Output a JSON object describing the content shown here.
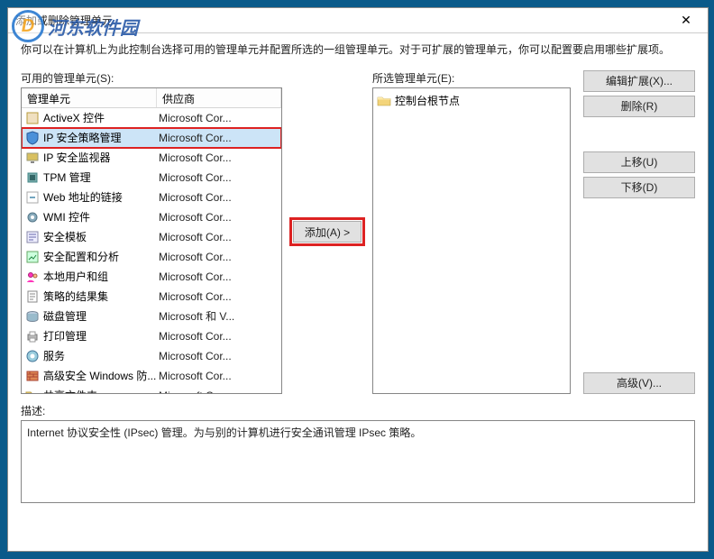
{
  "window": {
    "title": "添加或删除管理单元",
    "close_glyph": "✕"
  },
  "intro": "你可以在计算机上为此控制台选择可用的管理单元并配置所选的一组管理单元。对于可扩展的管理单元，你可以配置要启用哪些扩展项。",
  "available": {
    "label": "可用的管理单元(S):",
    "header_name": "管理单元",
    "header_vendor": "供应商",
    "items": [
      {
        "name": "ActiveX 控件",
        "vendor": "Microsoft Cor...",
        "icon": "activex"
      },
      {
        "name": "IP 安全策略管理",
        "vendor": "Microsoft Cor...",
        "icon": "shield",
        "selected": true
      },
      {
        "name": "IP 安全监视器",
        "vendor": "Microsoft Cor...",
        "icon": "monitor"
      },
      {
        "name": "TPM 管理",
        "vendor": "Microsoft Cor...",
        "icon": "chip"
      },
      {
        "name": "Web 地址的链接",
        "vendor": "Microsoft Cor...",
        "icon": "link"
      },
      {
        "name": "WMI 控件",
        "vendor": "Microsoft Cor...",
        "icon": "gear"
      },
      {
        "name": "安全模板",
        "vendor": "Microsoft Cor...",
        "icon": "template"
      },
      {
        "name": "安全配置和分析",
        "vendor": "Microsoft Cor...",
        "icon": "analysis"
      },
      {
        "name": "本地用户和组",
        "vendor": "Microsoft Cor...",
        "icon": "users"
      },
      {
        "name": "策略的结果集",
        "vendor": "Microsoft Cor...",
        "icon": "policy"
      },
      {
        "name": "磁盘管理",
        "vendor": "Microsoft 和 V...",
        "icon": "disk"
      },
      {
        "name": "打印管理",
        "vendor": "Microsoft Cor...",
        "icon": "printer"
      },
      {
        "name": "服务",
        "vendor": "Microsoft Cor...",
        "icon": "services"
      },
      {
        "name": "高级安全 Windows 防...",
        "vendor": "Microsoft Cor...",
        "icon": "firewall"
      },
      {
        "name": "共享文件夹",
        "vendor": "Microsoft Cor...",
        "icon": "folder"
      }
    ]
  },
  "selected": {
    "label": "所选管理单元(E):",
    "root": "控制台根节点"
  },
  "buttons": {
    "add": "添加(A) >",
    "edit_ext": "编辑扩展(X)...",
    "remove": "删除(R)",
    "move_up": "上移(U)",
    "move_down": "下移(D)",
    "advanced": "高级(V)..."
  },
  "description": {
    "label": "描述:",
    "text": "Internet 协议安全性 (IPsec) 管理。为与别的计算机进行安全通讯管理 IPsec 策略。"
  },
  "watermark": "河东软件园"
}
